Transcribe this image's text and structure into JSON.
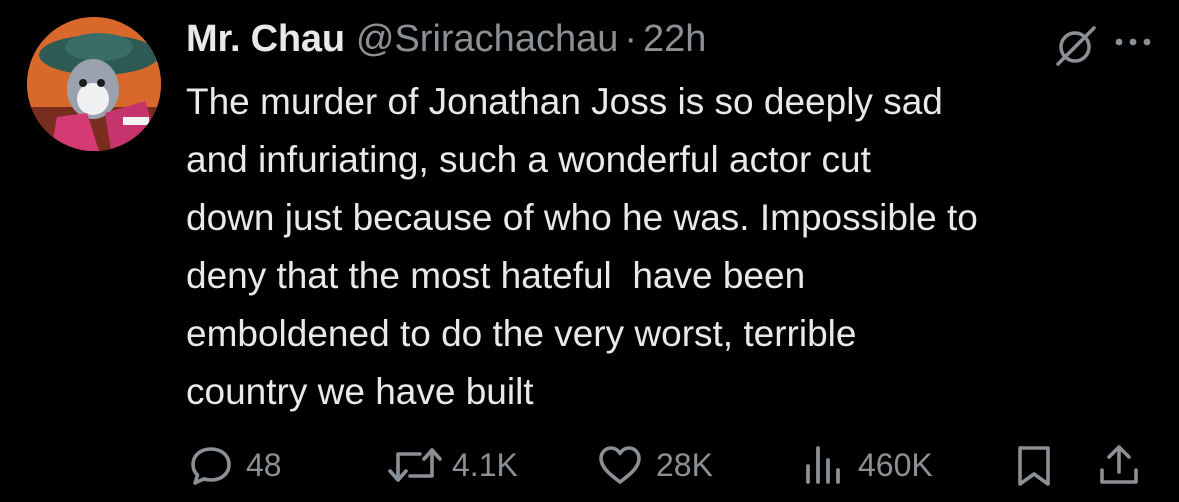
{
  "tweet": {
    "author_name": "Mr. Chau",
    "handle": "@Srirachachau",
    "separator": "·",
    "time": "22h",
    "body_lines": [
      "The murder of Jonathan Joss is so deeply sad",
      "and infuriating, such a wonderful actor cut",
      "down just because of who he was. Impossible to",
      "deny that the most hateful  have been",
      "emboldened to do the very worst, terrible",
      "country we have built"
    ]
  },
  "actions": {
    "replies": "48",
    "reposts": "4.1K",
    "likes": "28K",
    "views": "460K"
  },
  "icons": {
    "header": [
      "grok-icon",
      "more-icon"
    ],
    "actions": [
      "reply-icon",
      "repost-icon",
      "like-icon",
      "views-icon",
      "bookmark-icon",
      "share-icon"
    ]
  },
  "colors": {
    "background": "#000000",
    "primary_text": "#e7e9ea",
    "secondary_text": "#8b9095"
  }
}
